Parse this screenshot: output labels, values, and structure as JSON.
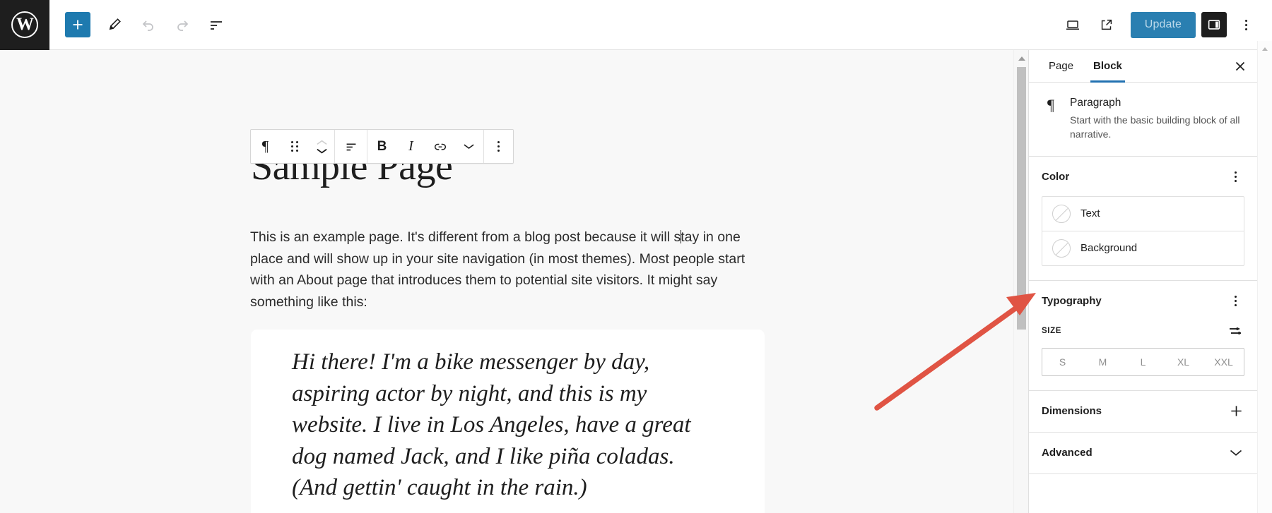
{
  "header": {
    "logo_icon": "wordpress-logo-icon",
    "logo_glyph": "W",
    "add_block_icon": "plus-icon",
    "tools_icon": "pencil-edit-icon",
    "undo_icon": "undo-arrow-icon",
    "redo_icon": "redo-arrow-icon",
    "list_view_icon": "document-outline-icon",
    "preview_icon": "desktop-preview-icon",
    "view_site_icon": "external-link-icon",
    "update_label": "Update",
    "settings_sidebar_icon": "sidebar-panel-icon",
    "options_icon": "kebab-menu-icon"
  },
  "block_toolbar": {
    "paragraph_icon": "paragraph-pilcrow-icon",
    "paragraph_glyph": "¶",
    "drag_icon": "drag-handle-icon",
    "move_up_icon": "chevron-up-icon",
    "move_down_icon": "chevron-down-icon",
    "align_icon": "text-align-left-icon",
    "bold_label": "B",
    "italic_label": "I",
    "link_icon": "link-icon",
    "more_rich_text_icon": "chevron-down-icon",
    "options_icon": "kebab-menu-icon"
  },
  "editor": {
    "post_title": "Sample Page",
    "paragraph_before_caret": "This is an example page. It's different from a blog post because it will s",
    "paragraph_after_caret": "tay in one place and will show up in your site navigation (in most themes). Most people start with an About page that introduces them to potential site visitors. It might say something like this:",
    "quote_text": "Hi there! I'm a bike messenger by day, aspiring actor by night, and this is my website. I live in Los Angeles, have a great dog named Jack, and I like piña coladas. (And gettin' caught in the rain.)"
  },
  "sidebar": {
    "tab_page": "Page",
    "tab_block": "Block",
    "close_icon": "close-x-icon",
    "block_card": {
      "icon": "paragraph-pilcrow-icon",
      "icon_glyph": "¶",
      "name": "Paragraph",
      "description": "Start with the basic building block of all narrative."
    },
    "color": {
      "title": "Color",
      "options_icon": "kebab-menu-icon",
      "rows": [
        {
          "label": "Text",
          "swatch_icon": "no-color-swatch-icon"
        },
        {
          "label": "Background",
          "swatch_icon": "no-color-swatch-icon"
        }
      ]
    },
    "typography": {
      "title": "Typography",
      "options_icon": "kebab-menu-icon",
      "size_label": "SIZE",
      "size_toggle_icon": "custom-size-sliders-icon",
      "sizes": [
        "S",
        "M",
        "L",
        "XL",
        "XXL"
      ]
    },
    "dimensions": {
      "title": "Dimensions",
      "icon": "plus-icon"
    },
    "advanced": {
      "title": "Advanced",
      "icon": "chevron-down-icon"
    }
  },
  "scrollbars": {
    "canvas_up_arrow_icon": "scroll-up-arrow-icon",
    "window_up_arrow_icon": "scroll-up-arrow-icon"
  },
  "annotation": {
    "arrow_icon": "red-pointer-arrow-icon",
    "color": "#e05444"
  }
}
